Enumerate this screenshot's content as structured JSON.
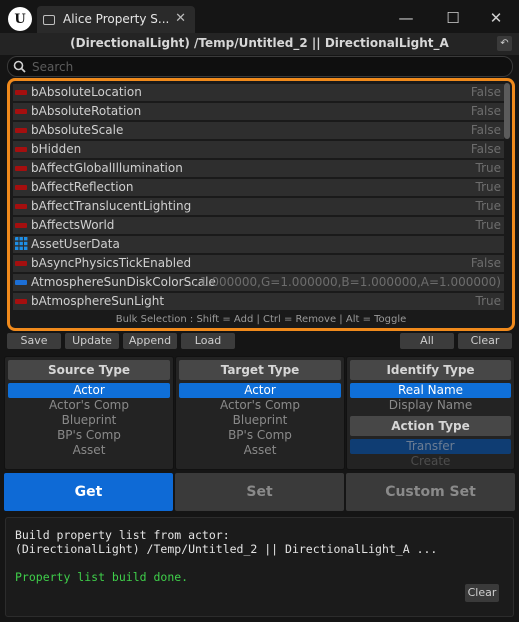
{
  "window": {
    "tab_title": "Alice Property S...",
    "close_glyph": "✕",
    "minimize_glyph": "—",
    "maximize_glyph": "☐",
    "window_close_glyph": "✕"
  },
  "header": {
    "path": "(DirectionalLight) /Temp/Untitled_2 || DirectionalLight_A",
    "back_glyph": "↶"
  },
  "search": {
    "placeholder": "Search",
    "value": ""
  },
  "properties": [
    {
      "name": "bAbsoluteLocation",
      "value": "False",
      "icon": "bool-pin",
      "icon_color": "#a50f0f"
    },
    {
      "name": "bAbsoluteRotation",
      "value": "False",
      "icon": "bool-pin",
      "icon_color": "#a50f0f"
    },
    {
      "name": "bAbsoluteScale",
      "value": "False",
      "icon": "bool-pin",
      "icon_color": "#a50f0f"
    },
    {
      "name": "bHidden",
      "value": "False",
      "icon": "bool-pin",
      "icon_color": "#a50f0f"
    },
    {
      "name": "bAffectGlobalIllumination",
      "value": "True",
      "icon": "bool-pin",
      "icon_color": "#a50f0f"
    },
    {
      "name": "bAffectReflection",
      "value": "True",
      "icon": "bool-pin",
      "icon_color": "#a50f0f"
    },
    {
      "name": "bAffectTranslucentLighting",
      "value": "True",
      "icon": "bool-pin",
      "icon_color": "#a50f0f"
    },
    {
      "name": "bAffectsWorld",
      "value": "True",
      "icon": "bool-pin",
      "icon_color": "#a50f0f"
    },
    {
      "name": "AssetUserData",
      "value": "",
      "icon": "array-grid",
      "icon_color": "#1e8fe6"
    },
    {
      "name": "bAsyncPhysicsTickEnabled",
      "value": "False",
      "icon": "bool-pin",
      "icon_color": "#a50f0f"
    },
    {
      "name": "AtmosphereSunDiskColorScale",
      "value": "...1.000000,G=1.000000,B=1.000000,A=1.000000)",
      "icon": "struct-pin",
      "icon_color": "#1c6fd6"
    },
    {
      "name": "bAtmosphereSunLight",
      "value": "True",
      "icon": "bool-pin",
      "icon_color": "#a50f0f"
    }
  ],
  "bulk_hint": "Bulk Selection : Shift = Add | Ctrl = Remove | Alt = Toggle",
  "toolbar": {
    "save": "Save",
    "update": "Update",
    "append": "Append",
    "load": "Load",
    "all": "All",
    "clear": "Clear"
  },
  "source_type": {
    "title": "Source Type",
    "options": [
      "Actor",
      "Actor's Comp",
      "Blueprint",
      "BP's Comp",
      "Asset"
    ],
    "selected": "Actor"
  },
  "target_type": {
    "title": "Target Type",
    "options": [
      "Actor",
      "Actor's Comp",
      "Blueprint",
      "BP's Comp",
      "Asset"
    ],
    "selected": "Actor"
  },
  "identify_type": {
    "title": "Identify Type",
    "options": [
      "Real Name",
      "Display Name"
    ],
    "selected": "Real Name"
  },
  "action_type": {
    "title": "Action Type",
    "options": [
      "Transfer",
      "Create"
    ],
    "selected": "Transfer"
  },
  "actions": {
    "get": "Get",
    "set": "Set",
    "custom_set": "Custom Set"
  },
  "log": {
    "line1": "Build property list from actor:",
    "line2": "(DirectionalLight) /Temp/Untitled_2 || DirectionalLight_A ...",
    "line3": "Property list build done.",
    "clear": "Clear"
  },
  "colors": {
    "accent_orange": "#f08a1c",
    "selected_blue": "#0f6fd8",
    "get_button": "#0e6ad6",
    "success_green": "#3fcf4a"
  }
}
